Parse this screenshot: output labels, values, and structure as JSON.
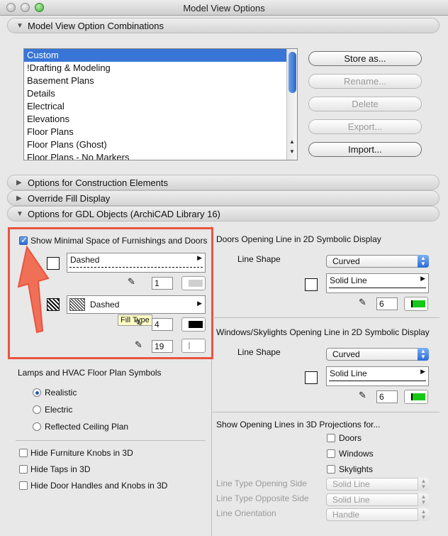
{
  "window": {
    "title": "Model View Options"
  },
  "sections": {
    "combinations": "Model View Option Combinations",
    "construction": "Options for Construction Elements",
    "override_fill": "Override Fill Display",
    "gdl": "Options for GDL Objects (ArchiCAD Library 16)"
  },
  "combination_list": [
    "Custom",
    "!Drafting & Modeling",
    "Basement Plans",
    "Details",
    "Electrical",
    "Elevations",
    "Floor Plans",
    "Floor Plans (Ghost)",
    "Floor Plans - No Markers"
  ],
  "buttons": {
    "store_as": "Store as...",
    "rename": "Rename...",
    "delete": "Delete",
    "export": "Export...",
    "import": "Import..."
  },
  "gdl_left": {
    "show_minimal_space": "Show Minimal Space of Furnishings and Doors",
    "line_type": "Dashed",
    "line_pen": "1",
    "fill_type": "Dashed",
    "fill_pen": "4",
    "fill_bg_pen": "19",
    "tooltip": "Fill Type",
    "lamps_title": "Lamps and HVAC Floor Plan Symbols",
    "radio_realistic": "Realistic",
    "radio_electric": "Electric",
    "radio_reflected": "Reflected Ceiling Plan",
    "hide_knobs": "Hide Furniture Knobs in 3D",
    "hide_taps": "Hide Taps in 3D",
    "hide_handles": "Hide Door Handles and Knobs in 3D"
  },
  "gdl_right": {
    "doors_title": "Doors Opening Line in 2D Symbolic Display",
    "doors_line_shape_label": "Line Shape",
    "doors_line_shape": "Curved",
    "doors_line_type": "Solid Line",
    "doors_pen": "6",
    "windows_title": "Windows/Skylights Opening Line in 2D Symbolic Display",
    "windows_line_shape_label": "Line Shape",
    "windows_line_shape": "Curved",
    "windows_line_type": "Solid Line",
    "windows_pen": "6",
    "show3d_title": "Show Opening Lines in 3D Projections for...",
    "doors_chk": "Doors",
    "windows_chk": "Windows",
    "skylights_chk": "Skylights",
    "lt_opening_label": "Line Type Opening Side",
    "lt_opening_value": "Solid Line",
    "lt_opposite_label": "Line Type Opposite Side",
    "lt_opposite_value": "Solid Line",
    "orientation_label": "Line Orientation",
    "orientation_value": "Handle"
  },
  "colors": {
    "accent": "#3875d7",
    "annotation": "#e8553f",
    "pen_green": "#18c818"
  }
}
